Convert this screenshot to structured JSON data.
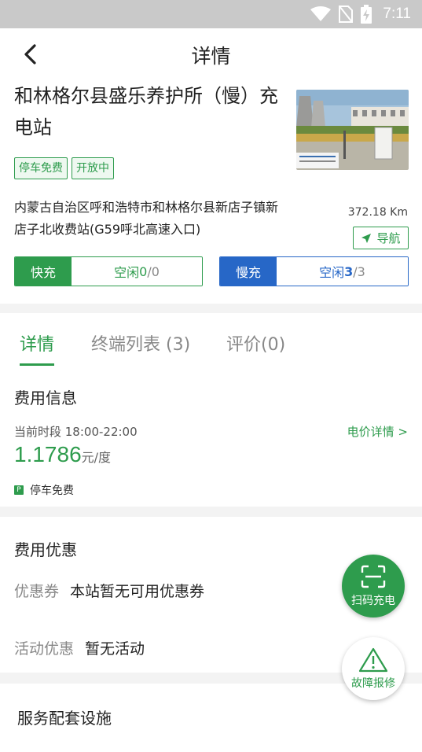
{
  "status_bar": {
    "time": "7:11"
  },
  "header": {
    "title": "详情"
  },
  "station": {
    "name": "和林格尔县盛乐养护所（慢）充电站",
    "tags": [
      "停车免费",
      "开放中"
    ],
    "address": "内蒙古自治区呼和浩特市和林格尔县新店子镇新店子北收费站(G59呼北高速入口)",
    "distance": "372.18 Km",
    "nav_label": "导航"
  },
  "fast_charge": {
    "label": "快充",
    "status": "空闲",
    "free": "0",
    "total": "/0"
  },
  "slow_charge": {
    "label": "慢充",
    "status": "空闲",
    "free": "3",
    "total": "/3"
  },
  "tabs": [
    {
      "label": "详情"
    },
    {
      "label": "终端列表 (3)"
    },
    {
      "label": "评价(0)"
    }
  ],
  "fee_info": {
    "title": "费用信息",
    "period": "当前时段 18:00-22:00",
    "price_link": "电价详情 >",
    "price": "1.1786",
    "unit": "元/度",
    "parking": "停车免费",
    "parking_icon_text": "P"
  },
  "discount": {
    "title": "费用优惠",
    "coupon_label": "优惠券",
    "coupon_value": "本站暂无可用优惠券",
    "activity_label": "活动优惠",
    "activity_value": "暂无活动"
  },
  "service": {
    "title": "服务配套设施"
  },
  "fab": {
    "scan_label": "扫码充电",
    "fault_label": "故障报修"
  },
  "colors": {
    "accent": "#2e9c4d",
    "slow": "#2767c7"
  }
}
